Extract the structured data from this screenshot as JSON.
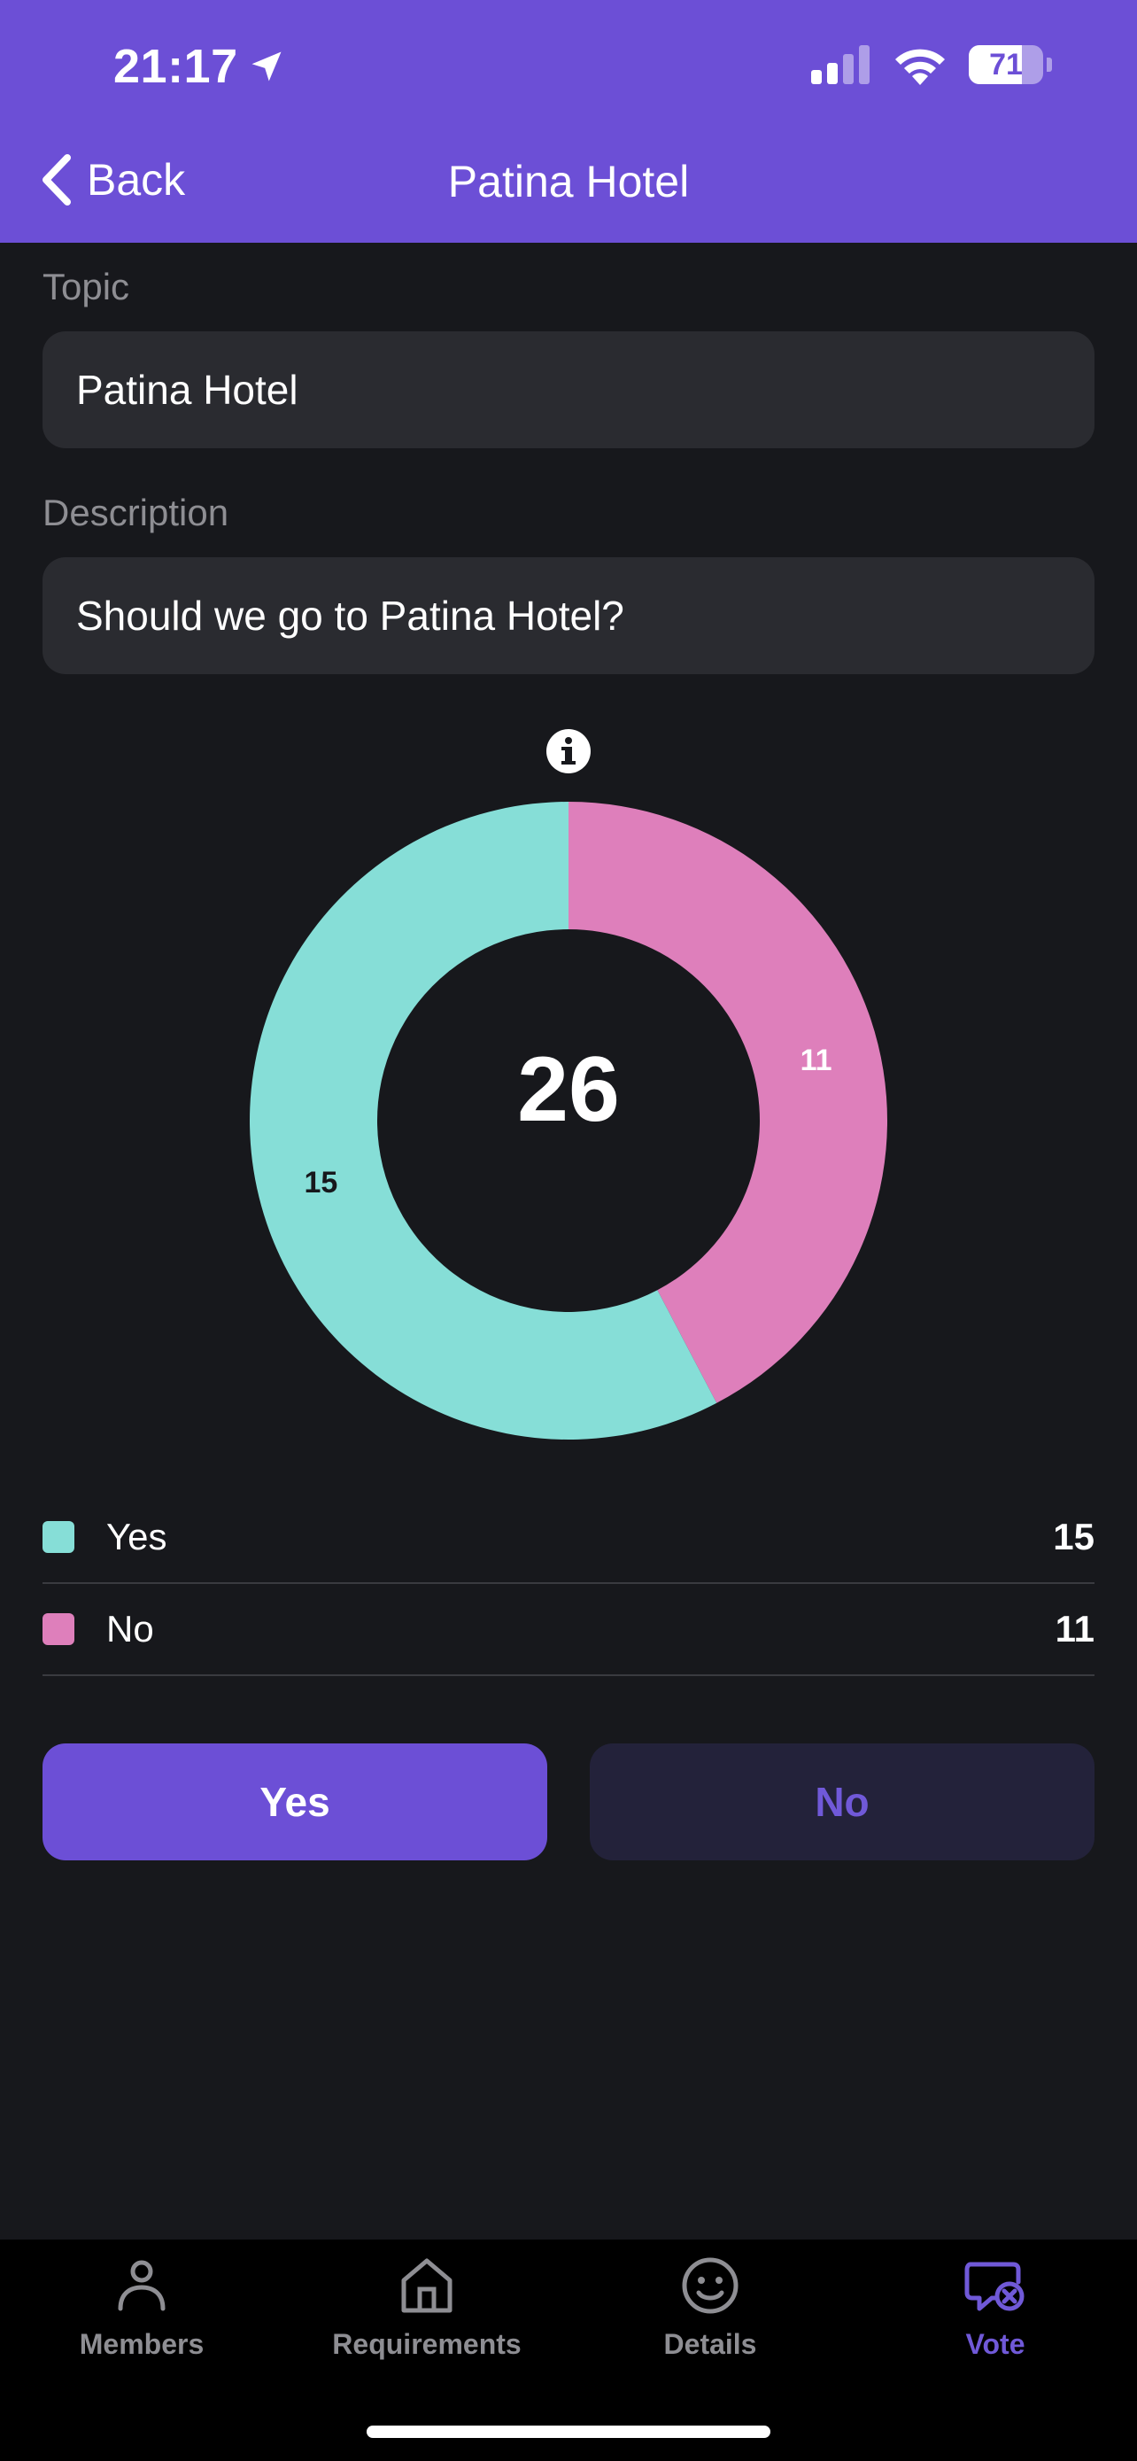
{
  "status_bar": {
    "time": "21:17",
    "battery": "71"
  },
  "nav": {
    "back_label": "Back",
    "title": "Patina Hotel"
  },
  "form": {
    "topic_label": "Topic",
    "topic_value": "Patina Hotel",
    "description_label": "Description",
    "description_value": "Should we go to Patina Hotel?"
  },
  "chart_data": {
    "type": "pie",
    "total": 26,
    "series": [
      {
        "name": "Yes",
        "value": 15,
        "color": "#86ded7"
      },
      {
        "name": "No",
        "value": 11,
        "color": "#de7fbb"
      }
    ]
  },
  "legend": [
    {
      "label": "Yes",
      "value": "15",
      "color": "#86ded7"
    },
    {
      "label": "No",
      "value": "11",
      "color": "#de7fbb"
    }
  ],
  "buttons": {
    "yes_label": "Yes",
    "no_label": "No"
  },
  "tabs": [
    {
      "label": "Members",
      "icon": "person-icon",
      "active": false
    },
    {
      "label": "Requirements",
      "icon": "house-icon",
      "active": false
    },
    {
      "label": "Details",
      "icon": "smiley-icon",
      "active": false
    },
    {
      "label": "Vote",
      "icon": "vote-bubble-icon",
      "active": true
    }
  ],
  "colors": {
    "accent": "#6c4fd6",
    "background": "#17181c",
    "field": "#2a2b30"
  }
}
